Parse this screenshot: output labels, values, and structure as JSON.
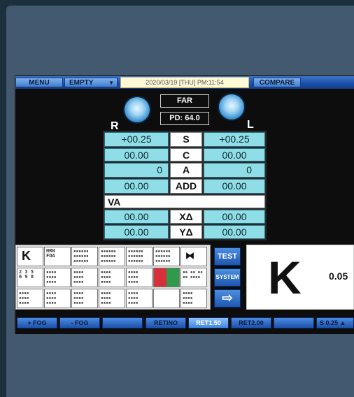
{
  "topbar": {
    "menu": "MENU",
    "preset": "EMPTY",
    "preset_arrow": "▼",
    "datetime": "2020/03/19 [THU] PM:11:54",
    "compare": "COMPARE"
  },
  "head": {
    "mode": "FAR",
    "pd": "PD: 64.0",
    "right": "R",
    "left": "L"
  },
  "grid": {
    "rows": [
      {
        "r": "+00.25",
        "label": "S",
        "l": "+00.25"
      },
      {
        "r": "00.00",
        "label": "C",
        "l": "00.00"
      },
      {
        "r": "0",
        "label": "A",
        "l": "0"
      },
      {
        "r": "00.00",
        "label": "ADD",
        "l": "00.00"
      }
    ],
    "va": "VA",
    "prism": [
      {
        "r": "00.00",
        "label": "XΔ",
        "l": "00.00"
      },
      {
        "r": "00.00",
        "label": "YΔ",
        "l": "00.00"
      }
    ]
  },
  "charts": {
    "k": "K",
    "nums": "2 3 5\n6 9 8",
    "lines": "HRN\nFDA",
    "butterfly": "⧓"
  },
  "side_buttons": {
    "test": "TEST",
    "system": "SYSTEM",
    "next": "⇨"
  },
  "display": {
    "optotype": "K",
    "acuity": "0.05"
  },
  "bottom": [
    {
      "label": "+ FOG"
    },
    {
      "label": "- FOG"
    },
    {
      "label": ""
    },
    {
      "label": "RETINO"
    },
    {
      "label": "RET1.50"
    },
    {
      "label": "RET2.00"
    },
    {
      "label": ""
    },
    {
      "label": "S 0.25 ▲"
    }
  ]
}
